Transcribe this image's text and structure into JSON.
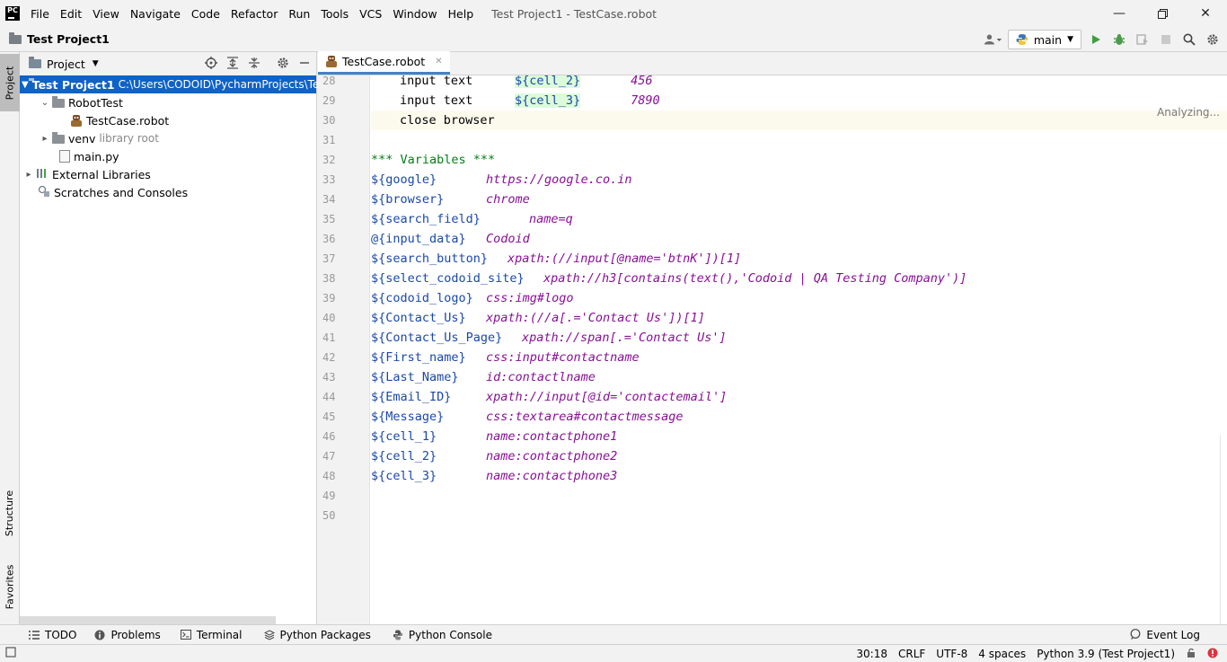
{
  "menubar": {
    "items": [
      "File",
      "Edit",
      "View",
      "Navigate",
      "Code",
      "Refactor",
      "Run",
      "Tools",
      "VCS",
      "Window",
      "Help"
    ],
    "title": "Test Project1 - TestCase.robot"
  },
  "navbar": {
    "project": "Test Project1",
    "run_config": "main"
  },
  "left_stripe": {
    "project": "Project",
    "structure": "Structure",
    "favorites": "Favorites"
  },
  "project_panel": {
    "title": "Project",
    "tree": [
      {
        "label": "Test Project1",
        "sub": "C:\\Users\\CODOID\\PycharmProjects\\Tes"
      },
      {
        "label": "RobotTest"
      },
      {
        "label": "TestCase.robot"
      },
      {
        "label": "venv",
        "sub": "library root"
      },
      {
        "label": "main.py"
      },
      {
        "label": "External Libraries"
      },
      {
        "label": "Scratches and Consoles"
      }
    ]
  },
  "editor": {
    "tab": "TestCase.robot",
    "status": "Analyzing...",
    "line_numbers": [
      "28",
      "29",
      "30",
      "31",
      "32",
      "33",
      "34",
      "35",
      "36",
      "37",
      "38",
      "39",
      "40",
      "41",
      "42",
      "43",
      "44",
      "45",
      "46",
      "47",
      "48",
      "49",
      "50"
    ],
    "lines": [
      {
        "indent": "    ",
        "kw": "input text",
        "var": "${cell_2}",
        "val": "456"
      },
      {
        "indent": "    ",
        "kw": "input text",
        "var": "${cell_3}",
        "val": "7890"
      },
      {
        "indent": "    ",
        "kw": "close browser"
      },
      {},
      {
        "header": "*** Variables ***"
      },
      {
        "name": "${google}",
        "value": "https://google.co.in"
      },
      {
        "name": "${browser}",
        "value": "chrome"
      },
      {
        "name": "${search_field}",
        "value": "name=q"
      },
      {
        "name": "@{input_data}",
        "value": "Codoid"
      },
      {
        "name": "${search_button}",
        "value": "xpath:(//input[@name='btnK'])[1]"
      },
      {
        "name": "${select_codoid_site}",
        "value": "xpath://h3[contains(text(),'Codoid | QA Testing Company')]"
      },
      {
        "name": "${codoid_logo}",
        "value": "css:img#logo"
      },
      {
        "name": "${Contact_Us}",
        "value": "xpath:(//a[.='Contact Us'])[1]"
      },
      {
        "name": "${Contact_Us_Page}",
        "value": "xpath://span[.='Contact Us']"
      },
      {
        "name": "${First_name}",
        "value": "css:input#contactname"
      },
      {
        "name": "${Last_Name}",
        "value": "id:contactlname"
      },
      {
        "name": "${Email_ID}",
        "value": "xpath://input[@id='contactemail']"
      },
      {
        "name": "${Message}",
        "value": "css:textarea#contactmessage"
      },
      {
        "name": "${cell_1}",
        "value": "name:contactphone1"
      },
      {
        "name": "${cell_2}",
        "value": "name:contactphone2"
      },
      {
        "name": "${cell_3}",
        "value": "name:contactphone3"
      },
      {},
      {}
    ]
  },
  "bottom_tools": {
    "todo": "TODO",
    "problems": "Problems",
    "terminal": "Terminal",
    "python_packages": "Python Packages",
    "python_console": "Python Console",
    "event_log": "Event Log"
  },
  "statusbar": {
    "position": "30:18",
    "line_sep": "CRLF",
    "encoding": "UTF-8",
    "indent": "4 spaces",
    "interpreter": "Python 3.9 (Test Project1)"
  }
}
